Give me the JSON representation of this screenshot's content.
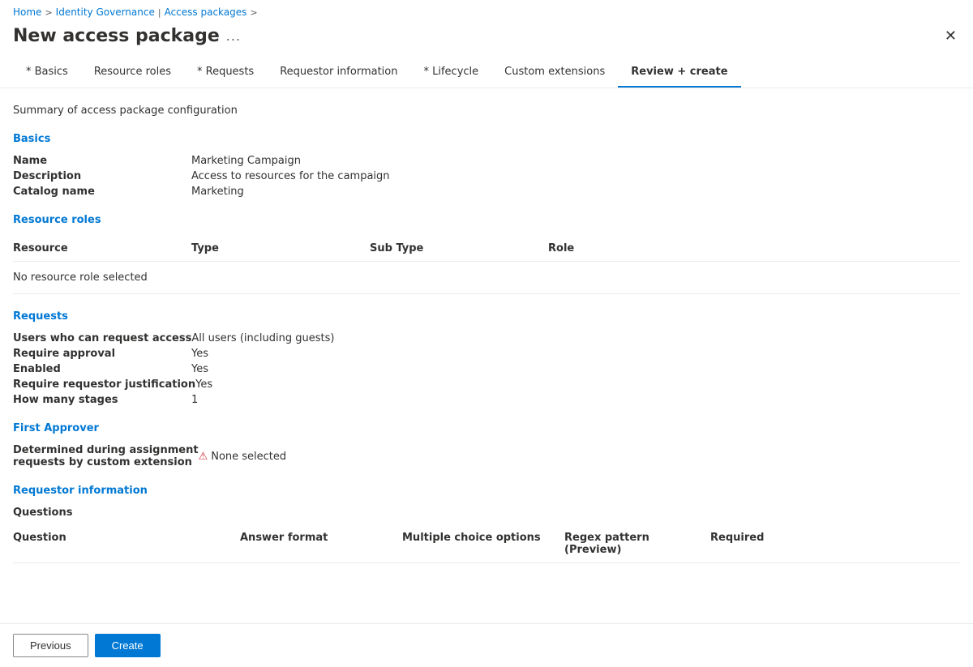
{
  "breadcrumb": {
    "home": "Home",
    "identity_governance": "Identity Governance",
    "separator": ">",
    "access_packages": "Access packages"
  },
  "page": {
    "title": "New access package",
    "more_label": "...",
    "summary_text": "Summary of access package configuration"
  },
  "tabs": [
    {
      "id": "basics",
      "label": "* Basics",
      "active": false
    },
    {
      "id": "resource-roles",
      "label": "Resource roles",
      "active": false
    },
    {
      "id": "requests",
      "label": "* Requests",
      "active": false
    },
    {
      "id": "requestor-information",
      "label": "Requestor information",
      "active": false
    },
    {
      "id": "lifecycle",
      "label": "* Lifecycle",
      "active": false
    },
    {
      "id": "custom-extensions",
      "label": "Custom extensions",
      "active": false
    },
    {
      "id": "review-create",
      "label": "Review + create",
      "active": true
    }
  ],
  "sections": {
    "basics": {
      "title": "Basics",
      "fields": [
        {
          "label": "Name",
          "value": "Marketing Campaign"
        },
        {
          "label": "Description",
          "value": "Access to resources for the campaign"
        },
        {
          "label": "Catalog name",
          "value": "Marketing"
        }
      ]
    },
    "resource_roles": {
      "title": "Resource roles",
      "columns": [
        "Resource",
        "Type",
        "Sub Type",
        "Role"
      ],
      "no_data": "No resource role selected"
    },
    "requests": {
      "title": "Requests",
      "fields": [
        {
          "label": "Users who can request access",
          "value": "All users (including guests)"
        },
        {
          "label": "Require approval",
          "value": "Yes"
        },
        {
          "label": "Enabled",
          "value": "Yes"
        },
        {
          "label": "Require requestor justification",
          "value": "Yes"
        },
        {
          "label": "How many stages",
          "value": "1"
        }
      ]
    },
    "first_approver": {
      "title": "First Approver",
      "fields": [
        {
          "label": "Determined during assignment\nrequests by custom extension",
          "value": "None selected",
          "has_error": true
        }
      ]
    },
    "requestor_information": {
      "title": "Requestor information",
      "questions_section": "Questions",
      "columns": [
        "Question",
        "Answer format",
        "Multiple choice options",
        "Regex pattern\n(Preview)",
        "Required"
      ]
    }
  },
  "footer": {
    "previous_label": "Previous",
    "create_label": "Create"
  }
}
